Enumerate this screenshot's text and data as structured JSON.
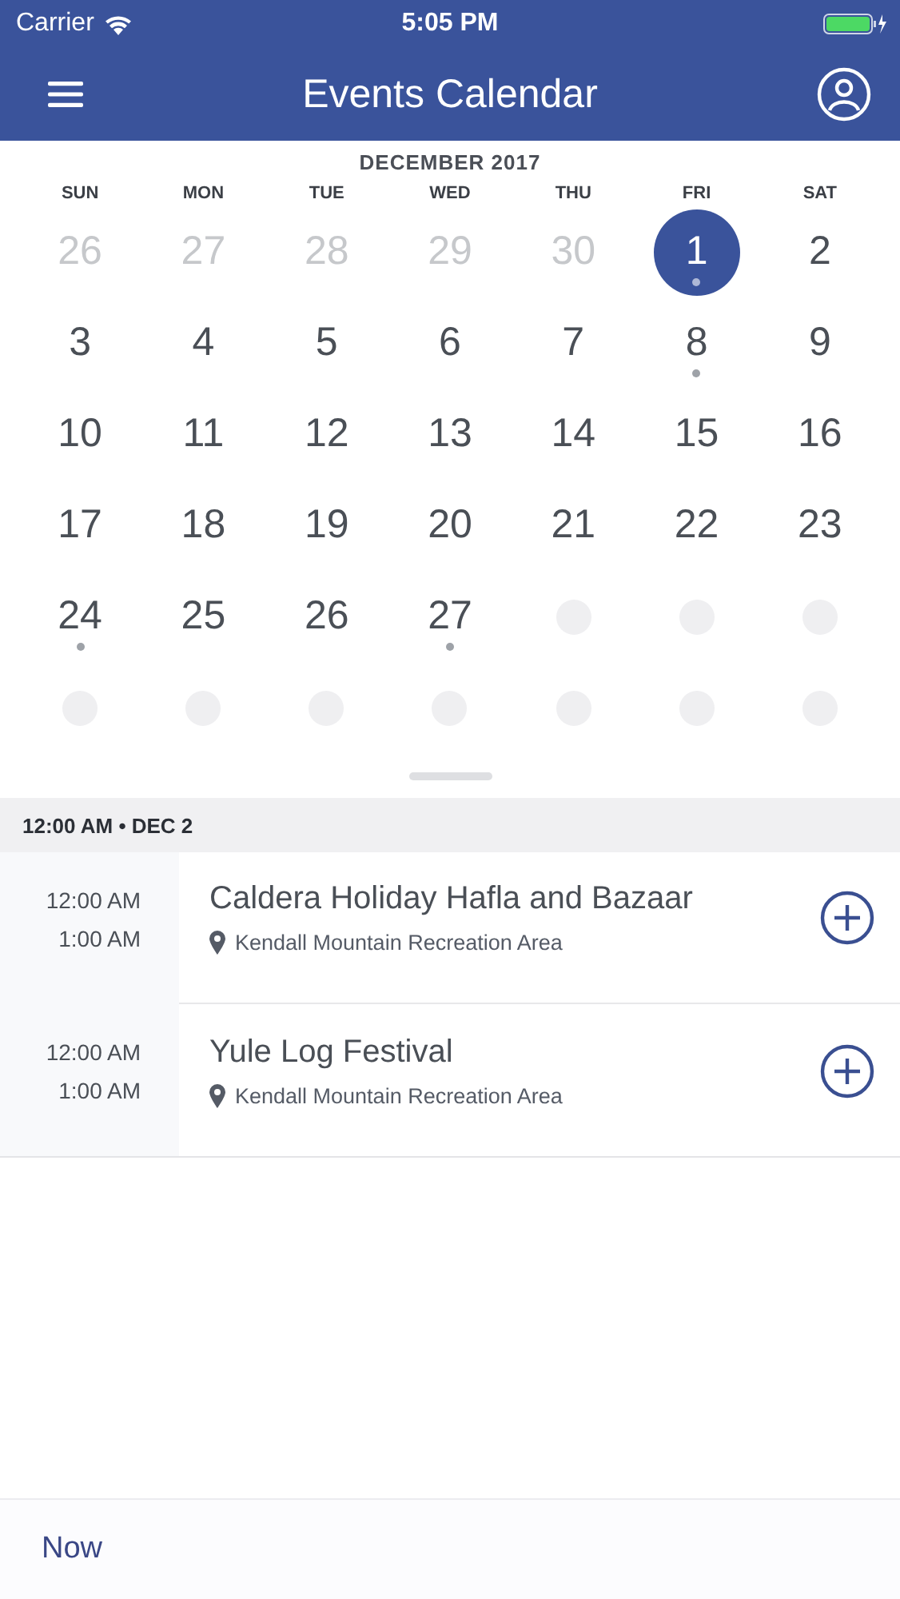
{
  "status_bar": {
    "carrier": "Carrier",
    "time": "5:05 PM"
  },
  "header": {
    "title": "Events Calendar"
  },
  "calendar": {
    "month": "DECEMBER 2017",
    "weekdays": [
      "SUN",
      "MON",
      "TUE",
      "WED",
      "THU",
      "FRI",
      "SAT"
    ],
    "days": [
      {
        "kind": "day",
        "text": "26",
        "outside": true,
        "selected": false,
        "has_event": false
      },
      {
        "kind": "day",
        "text": "27",
        "outside": true,
        "selected": false,
        "has_event": false
      },
      {
        "kind": "day",
        "text": "28",
        "outside": true,
        "selected": false,
        "has_event": false
      },
      {
        "kind": "day",
        "text": "29",
        "outside": true,
        "selected": false,
        "has_event": false
      },
      {
        "kind": "day",
        "text": "30",
        "outside": true,
        "selected": false,
        "has_event": false
      },
      {
        "kind": "day",
        "text": "1",
        "outside": false,
        "selected": true,
        "has_event": true
      },
      {
        "kind": "day",
        "text": "2",
        "outside": false,
        "selected": false,
        "has_event": false
      },
      {
        "kind": "day",
        "text": "3",
        "outside": false,
        "selected": false,
        "has_event": false
      },
      {
        "kind": "day",
        "text": "4",
        "outside": false,
        "selected": false,
        "has_event": false
      },
      {
        "kind": "day",
        "text": "5",
        "outside": false,
        "selected": false,
        "has_event": false
      },
      {
        "kind": "day",
        "text": "6",
        "outside": false,
        "selected": false,
        "has_event": false
      },
      {
        "kind": "day",
        "text": "7",
        "outside": false,
        "selected": false,
        "has_event": false
      },
      {
        "kind": "day",
        "text": "8",
        "outside": false,
        "selected": false,
        "has_event": true
      },
      {
        "kind": "day",
        "text": "9",
        "outside": false,
        "selected": false,
        "has_event": false
      },
      {
        "kind": "day",
        "text": "10",
        "outside": false,
        "selected": false,
        "has_event": false
      },
      {
        "kind": "day",
        "text": "11",
        "outside": false,
        "selected": false,
        "has_event": false
      },
      {
        "kind": "day",
        "text": "12",
        "outside": false,
        "selected": false,
        "has_event": false
      },
      {
        "kind": "day",
        "text": "13",
        "outside": false,
        "selected": false,
        "has_event": false
      },
      {
        "kind": "day",
        "text": "14",
        "outside": false,
        "selected": false,
        "has_event": false
      },
      {
        "kind": "day",
        "text": "15",
        "outside": false,
        "selected": false,
        "has_event": false
      },
      {
        "kind": "day",
        "text": "16",
        "outside": false,
        "selected": false,
        "has_event": false
      },
      {
        "kind": "day",
        "text": "17",
        "outside": false,
        "selected": false,
        "has_event": false
      },
      {
        "kind": "day",
        "text": "18",
        "outside": false,
        "selected": false,
        "has_event": false
      },
      {
        "kind": "day",
        "text": "19",
        "outside": false,
        "selected": false,
        "has_event": false
      },
      {
        "kind": "day",
        "text": "20",
        "outside": false,
        "selected": false,
        "has_event": false
      },
      {
        "kind": "day",
        "text": "21",
        "outside": false,
        "selected": false,
        "has_event": false
      },
      {
        "kind": "day",
        "text": "22",
        "outside": false,
        "selected": false,
        "has_event": false
      },
      {
        "kind": "day",
        "text": "23",
        "outside": false,
        "selected": false,
        "has_event": false
      },
      {
        "kind": "day",
        "text": "24",
        "outside": false,
        "selected": false,
        "has_event": true
      },
      {
        "kind": "day",
        "text": "25",
        "outside": false,
        "selected": false,
        "has_event": false
      },
      {
        "kind": "day",
        "text": "26",
        "outside": false,
        "selected": false,
        "has_event": false
      },
      {
        "kind": "day",
        "text": "27",
        "outside": false,
        "selected": false,
        "has_event": true
      },
      {
        "kind": "blank"
      },
      {
        "kind": "blank"
      },
      {
        "kind": "blank"
      },
      {
        "kind": "blank"
      },
      {
        "kind": "blank"
      },
      {
        "kind": "blank"
      },
      {
        "kind": "blank"
      },
      {
        "kind": "blank"
      },
      {
        "kind": "blank"
      },
      {
        "kind": "blank"
      }
    ]
  },
  "section_header": "12:00 AM • DEC 2",
  "events": [
    {
      "start": "12:00 AM",
      "end": "1:00 AM",
      "title": "Caldera Holiday Hafla and Bazaar",
      "location": "Kendall Mountain Recreation Area"
    },
    {
      "start": "12:00 AM",
      "end": "1:00 AM",
      "title": "Yule Log Festival",
      "location": "Kendall Mountain Recreation Area"
    }
  ],
  "footer": {
    "now_button": "Now"
  }
}
